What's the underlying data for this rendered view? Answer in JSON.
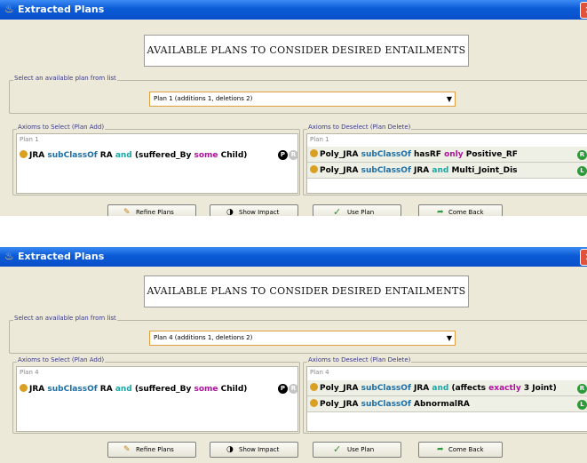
{
  "windows": [
    {
      "title": "Extracted Plans",
      "header": "AVAILABLE PLANS TO CONSIDER DESIRED ENTAILMENTS",
      "select_legend": "Select an available plan from list",
      "selected_plan": "Plan 1 (additions 1, deletions 2)",
      "add_legend": "Axioms to Select (Plan Add)",
      "add_plan_label": "Plan 1",
      "add_axiom": [
        {
          "t": "JRA ",
          "c": "b"
        },
        {
          "t": "subClassOf ",
          "c": "blue"
        },
        {
          "t": "RA ",
          "c": "b"
        },
        {
          "t": "and ",
          "c": "teal"
        },
        {
          "t": "(suffered_By ",
          "c": "b"
        },
        {
          "t": "some ",
          "c": "mag"
        },
        {
          "t": "Child)",
          "c": "b"
        }
      ],
      "add_badges": [
        "P",
        "R"
      ],
      "delete_legend": "Axioms to Deselect (Plan Delete)",
      "delete_plan_label": "Plan 1",
      "delete_axioms": [
        {
          "parts": [
            {
              "t": "Poly_JRA ",
              "c": "b"
            },
            {
              "t": "subClassOf ",
              "c": "blue"
            },
            {
              "t": "hasRF ",
              "c": "b"
            },
            {
              "t": "only ",
              "c": "mag"
            },
            {
              "t": "Positive_RF",
              "c": "b"
            }
          ],
          "badge": "R"
        },
        {
          "parts": [
            {
              "t": "Poly_JRA ",
              "c": "b"
            },
            {
              "t": "subClassOf ",
              "c": "blue"
            },
            {
              "t": "JRA ",
              "c": "b"
            },
            {
              "t": "and ",
              "c": "teal"
            },
            {
              "t": "Multi_Joint_Dis",
              "c": "b"
            }
          ],
          "badge": "L"
        }
      ],
      "buttons": {
        "refine": "Refine Plans",
        "impact": "Show Impact",
        "use": "Use Plan",
        "back": "Come Back"
      }
    },
    {
      "title": "Extracted Plans",
      "header": "AVAILABLE PLANS TO CONSIDER DESIRED ENTAILMENTS",
      "select_legend": "Select an available plan from list",
      "selected_plan": "Plan 4 (additions 1, deletions 2)",
      "add_legend": "Axioms to Select (Plan Add)",
      "add_plan_label": "Plan 4",
      "add_axiom": [
        {
          "t": "JRA ",
          "c": "b"
        },
        {
          "t": "subClassOf ",
          "c": "blue"
        },
        {
          "t": "RA ",
          "c": "b"
        },
        {
          "t": "and ",
          "c": "teal"
        },
        {
          "t": "(suffered_By ",
          "c": "b"
        },
        {
          "t": "some ",
          "c": "mag"
        },
        {
          "t": "Child)",
          "c": "b"
        }
      ],
      "add_badges": [
        "P",
        "R"
      ],
      "delete_legend": "Axioms to Deselect (Plan Delete)",
      "delete_plan_label": "Plan 4",
      "delete_axioms": [
        {
          "parts": [
            {
              "t": "Poly_JRA ",
              "c": "b"
            },
            {
              "t": "subClassOf ",
              "c": "blue"
            },
            {
              "t": "JRA ",
              "c": "b"
            },
            {
              "t": "and ",
              "c": "teal"
            },
            {
              "t": "(affects ",
              "c": "b"
            },
            {
              "t": "exactly ",
              "c": "mag"
            },
            {
              "t": "3 Joint)",
              "c": "b"
            }
          ],
          "badge": "R"
        },
        {
          "parts": [
            {
              "t": "Poly_JRA ",
              "c": "b"
            },
            {
              "t": "subClassOf ",
              "c": "blue"
            },
            {
              "t": "AbnormalRA",
              "c": "b"
            }
          ],
          "badge": "L"
        }
      ],
      "buttons": {
        "refine": "Refine Plans",
        "impact": "Show Impact",
        "use": "Use Plan",
        "back": "Come Back"
      }
    }
  ],
  "icons": {
    "window": "java-cup-icon",
    "close": "close-icon",
    "refine": "pencil-icon",
    "impact": "half-moon-icon",
    "use": "checkmark-icon",
    "back": "return-arrow-icon"
  },
  "colors": {
    "titlebar": "#0a5ad6",
    "keyword_blue": "#1c6ea4",
    "keyword_teal": "#17a8a8",
    "keyword_magenta": "#b0109e",
    "dot": "#d9a021",
    "badge_green": "#2e9b3a"
  }
}
